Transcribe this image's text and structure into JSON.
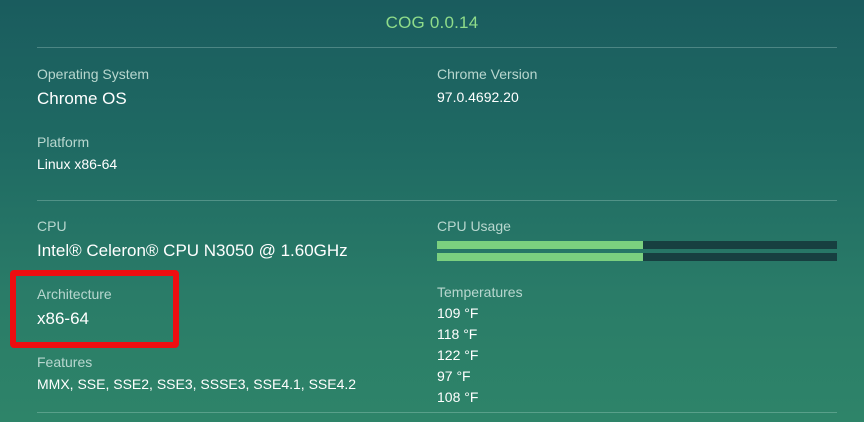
{
  "app": {
    "title": "COG 0.0.14"
  },
  "os": {
    "label": "Operating System",
    "value": "Chrome OS"
  },
  "chrome": {
    "label": "Chrome Version",
    "value": "97.0.4692.20"
  },
  "platform": {
    "label": "Platform",
    "value": "Linux x86-64"
  },
  "cpu": {
    "label": "CPU",
    "value": "Intel® Celeron® CPU N3050 @ 1.60GHz"
  },
  "cpu_usage": {
    "label": "CPU Usage",
    "cores": [
      {
        "usage_fraction": 0.515
      },
      {
        "usage_fraction": 0.515
      }
    ]
  },
  "architecture": {
    "label": "Architecture",
    "value": "x86-64"
  },
  "temperatures": {
    "label": "Temperatures",
    "values": [
      "109 °F",
      "118 °F",
      "122 °F",
      "97 °F",
      "108 °F"
    ]
  },
  "features": {
    "label": "Features",
    "value": "MMX, SSE, SSE2, SSE3, SSSE3, SSE4.1, SSE4.2"
  },
  "colors": {
    "title": "#8fdc8a",
    "usage_fill": "#7bd07f",
    "usage_track": "#173f40",
    "highlight": "#ee0d10"
  }
}
